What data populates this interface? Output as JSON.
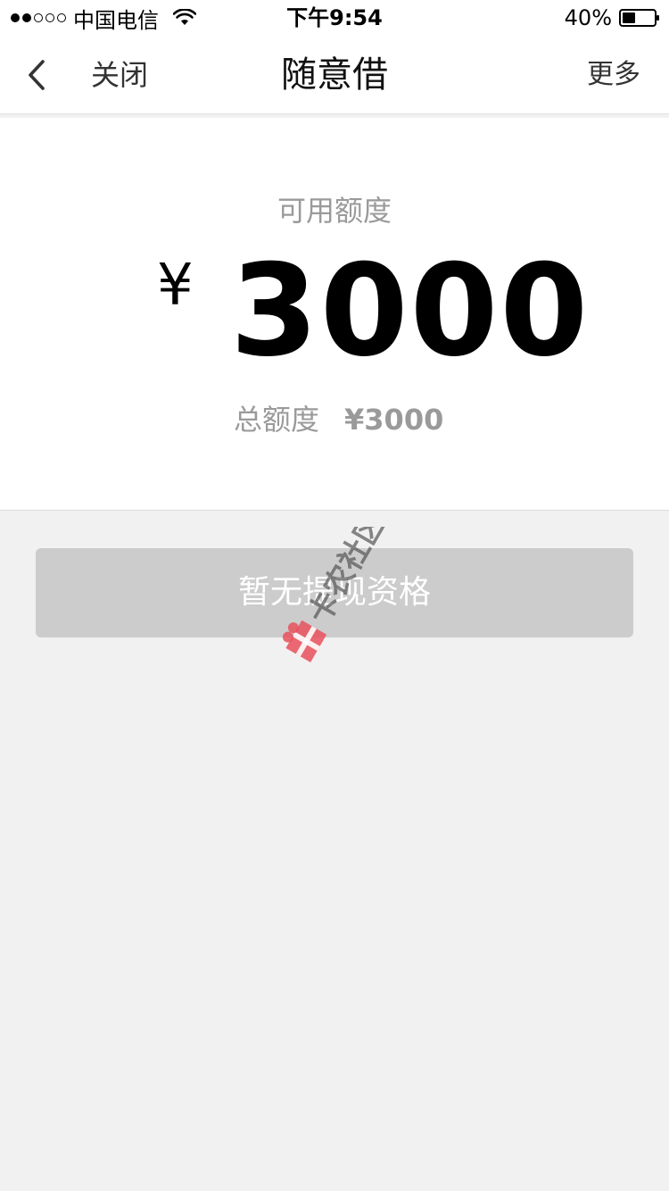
{
  "status_bar": {
    "carrier": "中国电信",
    "time": "下午9:54",
    "battery_percent": "40%",
    "battery_level": 0.4,
    "signal_strength": 2,
    "signal_total": 5
  },
  "nav": {
    "close_label": "关闭",
    "title": "随意借",
    "more_label": "更多"
  },
  "credit": {
    "available_label": "可用额度",
    "currency_symbol": "¥",
    "available_amount": "3000",
    "total_label": "总额度",
    "total_amount": "¥3000"
  },
  "action": {
    "withdraw_label": "暂无提现资格"
  },
  "watermark": {
    "text": "卡农社区",
    "color": "#e8505b"
  }
}
